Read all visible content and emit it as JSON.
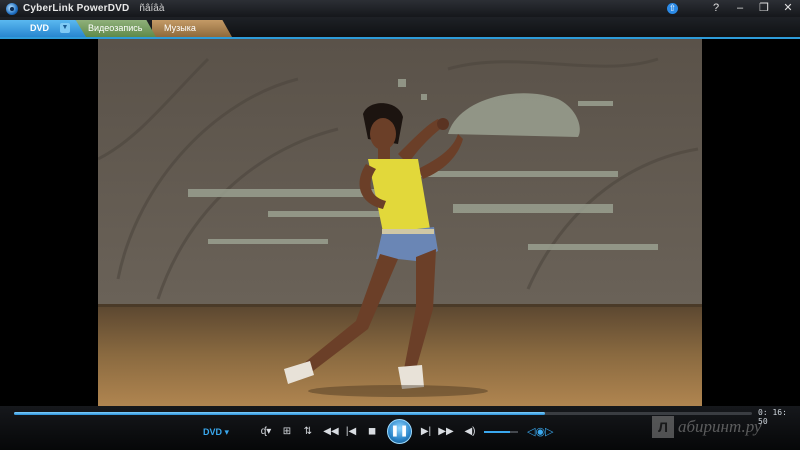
{
  "window": {
    "title": "CyberLink PowerDVD",
    "menu_label": "ñâíâà",
    "icons": [
      "app-logo-icon",
      "upgrade-icon",
      "help-icon",
      "minimize-icon",
      "restore-icon",
      "close-icon"
    ],
    "help_glyph": "?",
    "minimize_glyph": "–",
    "restore_glyph": "❐",
    "close_glyph": "✕"
  },
  "tabs": [
    {
      "label": "DVD",
      "active": true
    },
    {
      "label": "Видеозапись",
      "active": false
    },
    {
      "label": "Музыка",
      "active": false
    }
  ],
  "playback": {
    "progress": 0.72,
    "time": "0: 16: 50",
    "source_label": "DVD ▾",
    "volume": 0.75,
    "playing": true
  },
  "controls": {
    "buttons": [
      {
        "name": "audio-stream-button",
        "glyph": "ᶑ▾"
      },
      {
        "name": "chapters-grid-button",
        "glyph": "⊞"
      },
      {
        "name": "settings-sliders-button",
        "glyph": "⇅"
      },
      {
        "name": "rewind-button",
        "glyph": "◀◀"
      },
      {
        "name": "previous-button",
        "glyph": "|◀"
      },
      {
        "name": "stop-button",
        "glyph": "◼"
      },
      {
        "name": "next-button",
        "glyph": "▶|"
      },
      {
        "name": "fast-forward-button",
        "glyph": "▶▶"
      },
      {
        "name": "volume-button",
        "glyph": "◀)"
      }
    ],
    "play_glyph": "❚❚",
    "view_glyph": "◁◉▷"
  },
  "watermark": {
    "box": "Л",
    "text": "абиринт.ру"
  },
  "colors": {
    "accent": "#2e9bd9",
    "tab_dvd": "#3a9ee0",
    "tab_video": "#7a9c62",
    "tab_music": "#a97f4d"
  }
}
